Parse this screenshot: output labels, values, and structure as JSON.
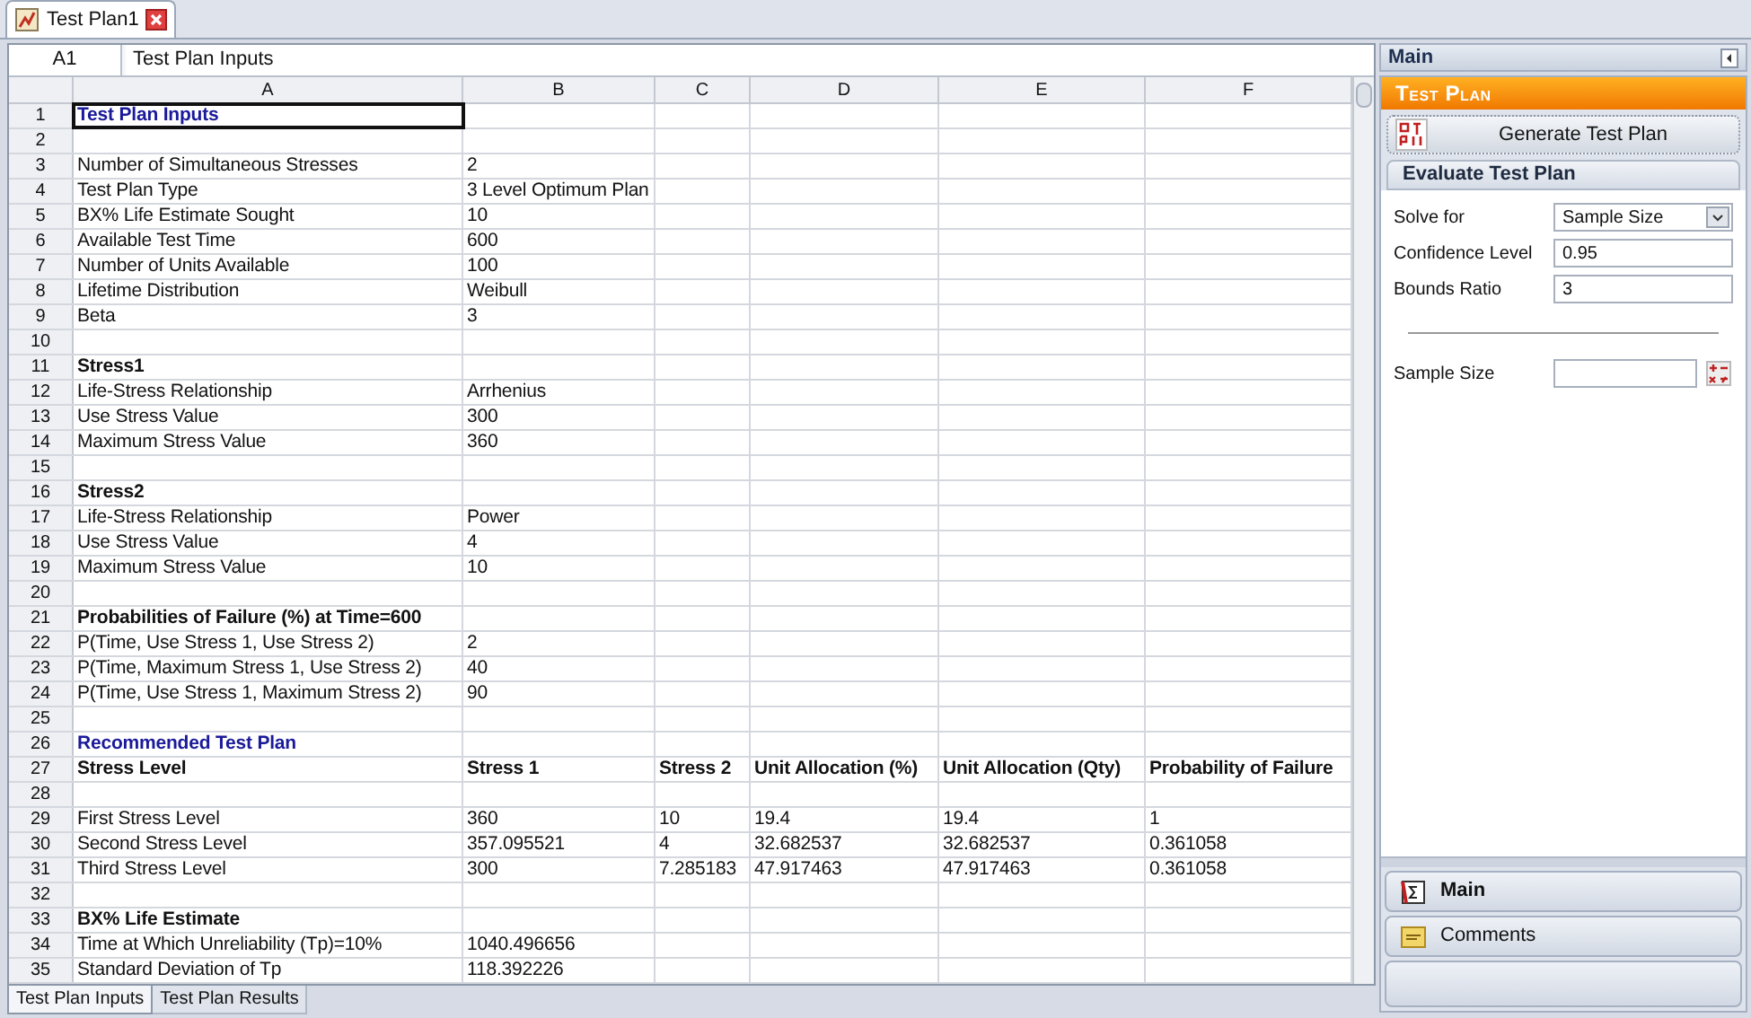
{
  "document_tab": {
    "title": "Test Plan1"
  },
  "formula_bar": {
    "cell": "A1",
    "value": "Test Plan Inputs"
  },
  "columns": [
    "A",
    "B",
    "C",
    "D",
    "E",
    "F"
  ],
  "rows": [
    {
      "number": "1",
      "kind": "heading",
      "selected": true,
      "cells": [
        "Test Plan Inputs"
      ]
    },
    {
      "number": "2",
      "selected": false
    },
    {
      "number": "3",
      "kind": "plain",
      "selected": false,
      "cells": [
        "Number of Simultaneous Stresses",
        "2"
      ]
    },
    {
      "number": "4",
      "kind": "plain",
      "selected": false,
      "cells": [
        "Test Plan Type",
        "3 Level Optimum Plan"
      ]
    },
    {
      "number": "5",
      "kind": "plain",
      "selected": false,
      "cells": [
        "BX% Life Estimate Sought",
        "10"
      ]
    },
    {
      "number": "6",
      "kind": "plain",
      "selected": false,
      "cells": [
        "Available Test Time",
        "600"
      ]
    },
    {
      "number": "7",
      "kind": "plain",
      "selected": false,
      "cells": [
        "Number of Units Available",
        "100"
      ]
    },
    {
      "number": "8",
      "kind": "plain",
      "selected": false,
      "cells": [
        "Lifetime Distribution",
        "Weibull"
      ]
    },
    {
      "number": "9",
      "kind": "plain",
      "selected": false,
      "cells": [
        "Beta",
        "3"
      ]
    },
    {
      "number": "10",
      "selected": false
    },
    {
      "number": "11",
      "kind": "bold",
      "selected": false,
      "cells": [
        "Stress1"
      ]
    },
    {
      "number": "12",
      "kind": "plain",
      "selected": false,
      "cells": [
        "Life-Stress Relationship",
        "Arrhenius"
      ]
    },
    {
      "number": "13",
      "kind": "plain",
      "selected": false,
      "cells": [
        "Use Stress Value",
        "300"
      ]
    },
    {
      "number": "14",
      "kind": "plain",
      "selected": false,
      "cells": [
        "Maximum Stress Value",
        "360"
      ]
    },
    {
      "number": "15",
      "selected": false
    },
    {
      "number": "16",
      "kind": "bold",
      "selected": false,
      "cells": [
        "Stress2"
      ]
    },
    {
      "number": "17",
      "kind": "plain",
      "selected": false,
      "cells": [
        "Life-Stress Relationship",
        "Power"
      ]
    },
    {
      "number": "18",
      "kind": "plain",
      "selected": false,
      "cells": [
        "Use Stress Value",
        "4"
      ]
    },
    {
      "number": "19",
      "kind": "plain",
      "selected": false,
      "cells": [
        "Maximum Stress Value",
        "10"
      ]
    },
    {
      "number": "20",
      "selected": false
    },
    {
      "number": "21",
      "kind": "bold",
      "selected": false,
      "cells": [
        "Probabilities of Failure (%) at Time=600"
      ]
    },
    {
      "number": "22",
      "kind": "plain",
      "selected": false,
      "cells": [
        "P(Time, Use Stress 1, Use Stress 2)",
        "2"
      ]
    },
    {
      "number": "23",
      "kind": "plain",
      "selected": false,
      "cells": [
        "P(Time, Maximum Stress 1, Use Stress 2)",
        "40"
      ]
    },
    {
      "number": "24",
      "kind": "plain",
      "selected": false,
      "cells": [
        "P(Time, Use Stress 1, Maximum Stress 2)",
        "90"
      ]
    },
    {
      "number": "25",
      "selected": false
    },
    {
      "number": "26",
      "kind": "heading",
      "selected": false,
      "cells": [
        "Recommended Test Plan"
      ]
    },
    {
      "number": "27",
      "kind": "bold",
      "selected": false,
      "cells": [
        "Stress Level",
        "Stress 1",
        "Stress 2",
        "Unit Allocation (%)",
        "Unit Allocation (Qty)",
        "Probability of Failure"
      ]
    },
    {
      "number": "28",
      "selected": false
    },
    {
      "number": "29",
      "kind": "plain",
      "selected": false,
      "cells": [
        "First Stress Level",
        "360",
        "10",
        "19.4",
        "19.4",
        "1"
      ]
    },
    {
      "number": "30",
      "kind": "plain",
      "selected": false,
      "cells": [
        "Second Stress Level",
        "357.095521",
        "4",
        "32.682537",
        "32.682537",
        "0.361058"
      ]
    },
    {
      "number": "31",
      "kind": "plain",
      "selected": false,
      "cells": [
        "Third Stress Level",
        "300",
        "7.285183",
        "47.917463",
        "47.917463",
        "0.361058"
      ]
    },
    {
      "number": "32",
      "selected": false
    },
    {
      "number": "33",
      "kind": "bold",
      "selected": false,
      "cells": [
        "BX% Life Estimate"
      ]
    },
    {
      "number": "34",
      "kind": "plain",
      "selected": false,
      "cells": [
        "Time at Which Unreliability (Tp)=10%",
        "1040.496656"
      ]
    },
    {
      "number": "35",
      "kind": "plain",
      "selected": false,
      "cells": [
        "Standard Deviation of Tp",
        "118.392226"
      ]
    }
  ],
  "sheet_tabs": [
    {
      "label": "Test Plan Inputs",
      "selected": true
    },
    {
      "label": "Test Plan Results",
      "selected": false
    }
  ],
  "panel": {
    "title": "Main",
    "banner": "Test Plan",
    "generate_button": "Generate Test Plan",
    "evaluate": {
      "title": "Evaluate Test Plan",
      "solve_for": {
        "label": "Solve for",
        "value": "Sample Size"
      },
      "confidence": {
        "label": "Confidence Level",
        "value": "0.95"
      },
      "bounds": {
        "label": "Bounds Ratio",
        "value": "3"
      },
      "result": {
        "label": "Sample Size"
      }
    },
    "nav": [
      {
        "label": "Main",
        "selected": true
      },
      {
        "label": "Comments",
        "selected": false
      }
    ]
  }
}
